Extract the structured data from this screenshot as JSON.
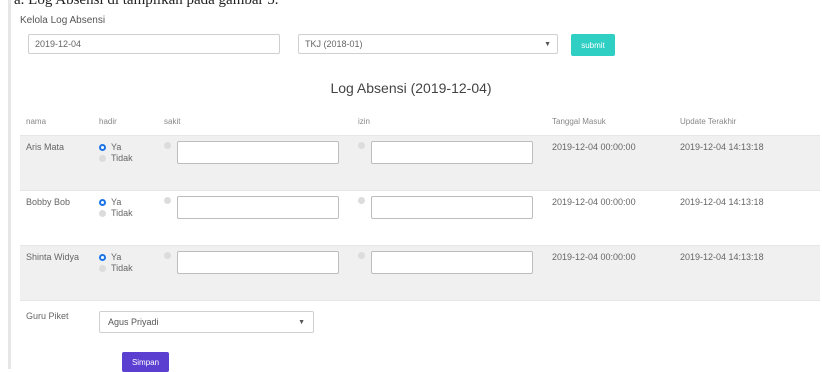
{
  "header": {
    "cut_text": "a. Log Absensi di tampilkan pada gambar 5."
  },
  "panel": {
    "title": "Kelola Log Absensi"
  },
  "filters": {
    "date_value": "2019-12-04",
    "class_value": "TKJ (2018-01)",
    "submit_label": "submit"
  },
  "table_title": "Log Absensi (2019-12-04)",
  "columns": [
    "nama",
    "hadir",
    "sakit",
    "izin",
    "Tanggal Masuk",
    "Update Terakhir"
  ],
  "options": {
    "yes": "Ya",
    "no": "Tidak"
  },
  "rows": [
    {
      "nama": "Aris Mata",
      "tanggal_masuk": "2019-12-04 00:00:00",
      "update_terakhir": "2019-12-04 14:13:18"
    },
    {
      "nama": "Bobby Bob",
      "tanggal_masuk": "2019-12-04 00:00:00",
      "update_terakhir": "2019-12-04 14:13:18"
    },
    {
      "nama": "Shinta Widya",
      "tanggal_masuk": "2019-12-04 00:00:00",
      "update_terakhir": "2019-12-04 14:13:18"
    }
  ],
  "guru_piket": {
    "label": "Guru Piket",
    "value": "Agus Priyadi"
  },
  "save_label": "Simpan",
  "colors": {
    "submit": "#2fcfc4",
    "simpan": "#5b3fd1",
    "radio_on": "#1a73e8"
  }
}
